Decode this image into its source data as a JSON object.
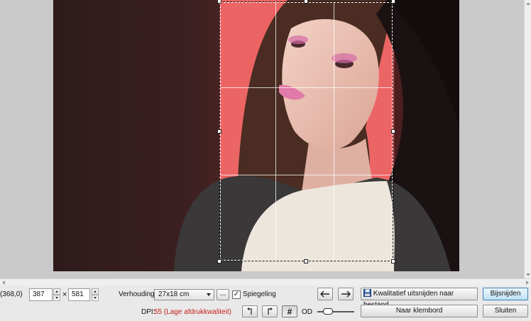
{
  "coords": "(368,0)",
  "size": {
    "width": "387",
    "separator": "×",
    "height": "581"
  },
  "ratio": {
    "label": "Verhouding:",
    "value": "27x18 cm",
    "more_label": "..."
  },
  "mirror": {
    "label": "Spiegeling",
    "checked": true,
    "mark": "✓"
  },
  "dpi": {
    "label": "DPI:",
    "value": "55 (Lage afdrukkwaliteit)"
  },
  "rotate": {
    "left_icon": "rotate-left-icon",
    "right_icon": "rotate-right-icon",
    "grid_icon": "grid-icon",
    "grid_glyph": "#",
    "od_label": "OD"
  },
  "nav": {
    "prev_icon": "arrow-left-icon",
    "next_icon": "arrow-right-icon"
  },
  "actions": {
    "save_icon": "floppy-disk-icon",
    "save_label": "Kwalitatief uitsnijden naar bestand",
    "clipboard_label": "Naar klembord",
    "crop_label": "Bijsnijden",
    "close_label": "Sluiten"
  },
  "slider": {
    "value": 0.2
  },
  "colors": {
    "primary_button": "#bfe0f5",
    "dpi_warning": "#c0201a"
  }
}
